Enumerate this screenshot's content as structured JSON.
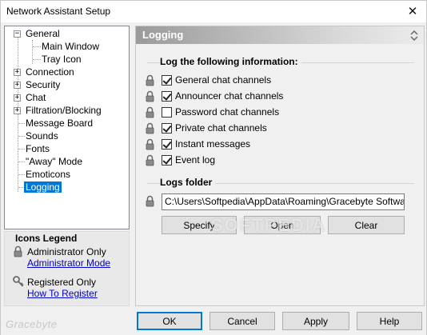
{
  "window": {
    "title": "Network Assistant Setup",
    "close_glyph": "✕"
  },
  "tree": {
    "items": [
      {
        "label": "General",
        "expander": "−"
      },
      {
        "label": "Main Window"
      },
      {
        "label": "Tray Icon"
      },
      {
        "label": "Connection",
        "expander": "+"
      },
      {
        "label": "Security",
        "expander": "+"
      },
      {
        "label": "Chat",
        "expander": "+"
      },
      {
        "label": "Filtration/Blocking",
        "expander": "+"
      },
      {
        "label": "Message Board"
      },
      {
        "label": "Sounds"
      },
      {
        "label": "Fonts"
      },
      {
        "label": "\"Away\" Mode"
      },
      {
        "label": "Emoticons"
      },
      {
        "label": "Logging",
        "selected": true
      }
    ]
  },
  "legend": {
    "title": "Icons Legend",
    "admin_label": "Administrator Only",
    "admin_link": "Administrator Mode",
    "registered_label": "Registered Only",
    "registered_link": "How To Register"
  },
  "panel": {
    "title": "Logging",
    "log_group_title": "Log the following information:",
    "options": [
      {
        "label": "General chat channels",
        "checked": true
      },
      {
        "label": "Announcer chat channels",
        "checked": true
      },
      {
        "label": "Password chat channels",
        "checked": false
      },
      {
        "label": "Private chat channels",
        "checked": true
      },
      {
        "label": "Instant messages",
        "checked": true
      },
      {
        "label": "Event log",
        "checked": true
      }
    ],
    "logs_folder_title": "Logs folder",
    "logs_folder_path": "C:\\Users\\Softpedia\\AppData\\Roaming\\Gracebyte Software\\Ne",
    "specify_label": "Specify",
    "open_label": "Open",
    "clear_label": "Clear"
  },
  "footer": {
    "ok_label": "OK",
    "cancel_label": "Cancel",
    "apply_label": "Apply",
    "help_label": "Help",
    "brand": "Gracebyte"
  },
  "watermark": "SOFTPEDIA",
  "colors": {
    "selection": "#0078d7",
    "link": "#0000cc",
    "header_gradient_start": "#9a9a9a"
  },
  "icons": {
    "lock": "lock-icon",
    "key": "key-icon"
  }
}
